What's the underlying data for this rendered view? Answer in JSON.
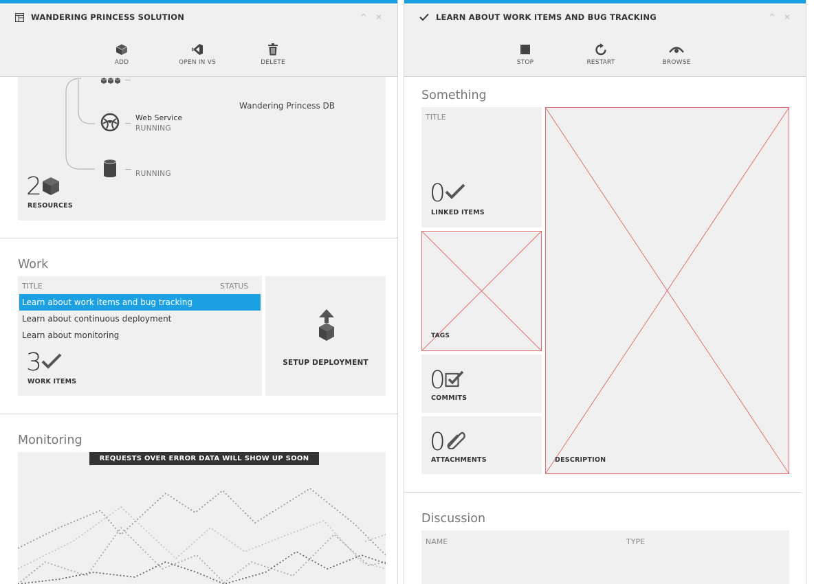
{
  "left_blade": {
    "title": "WANDERING PRINCESS SOLUTION",
    "commands": [
      {
        "label": "ADD"
      },
      {
        "label": "OPEN IN VS"
      },
      {
        "label": "DELETE"
      }
    ],
    "resources": {
      "web_service_name": "Web Service",
      "web_service_status": "RUNNING",
      "db_status": "RUNNING",
      "db_name": "Wandering Princess DB",
      "count": "2",
      "count_label": "RESOURCES"
    },
    "work": {
      "section_title": "Work",
      "col_title": "TITLE",
      "col_status": "STATUS",
      "items": [
        {
          "title": "Learn about work items and bug tracking",
          "selected": true
        },
        {
          "title": "Learn about continuous deployment",
          "selected": false
        },
        {
          "title": "Learn about monitoring",
          "selected": false
        }
      ],
      "count": "3",
      "count_label": "WORK ITEMS",
      "deploy_label": "SETUP DEPLOYMENT"
    },
    "monitoring": {
      "section_title": "Monitoring",
      "banner": "REQUESTS OVER ERROR DATA WILL SHOW UP SOON"
    }
  },
  "right_blade": {
    "title": "LEARN ABOUT WORK ITEMS AND BUG TRACKING",
    "commands": [
      {
        "label": "STOP"
      },
      {
        "label": "RESTART"
      },
      {
        "label": "BROWSE"
      }
    ],
    "something": {
      "section_title": "Something",
      "title_label": "TITLE",
      "linked_count": "0",
      "linked_label": "LINKED ITEMS",
      "tags_label": "TAGS",
      "commits_count": "0",
      "commits_label": "COMMITS",
      "attachments_count": "0",
      "attachments_label": "ATTACHMENTS",
      "description_label": "DESCRIPTION"
    },
    "discussion": {
      "section_title": "Discussion",
      "col_name": "NAME",
      "col_type": "TYPE"
    }
  },
  "colors": {
    "accent": "#1ba1e2",
    "tile_bg": "#f0f0f0",
    "placeholder_x": "#e07070"
  }
}
